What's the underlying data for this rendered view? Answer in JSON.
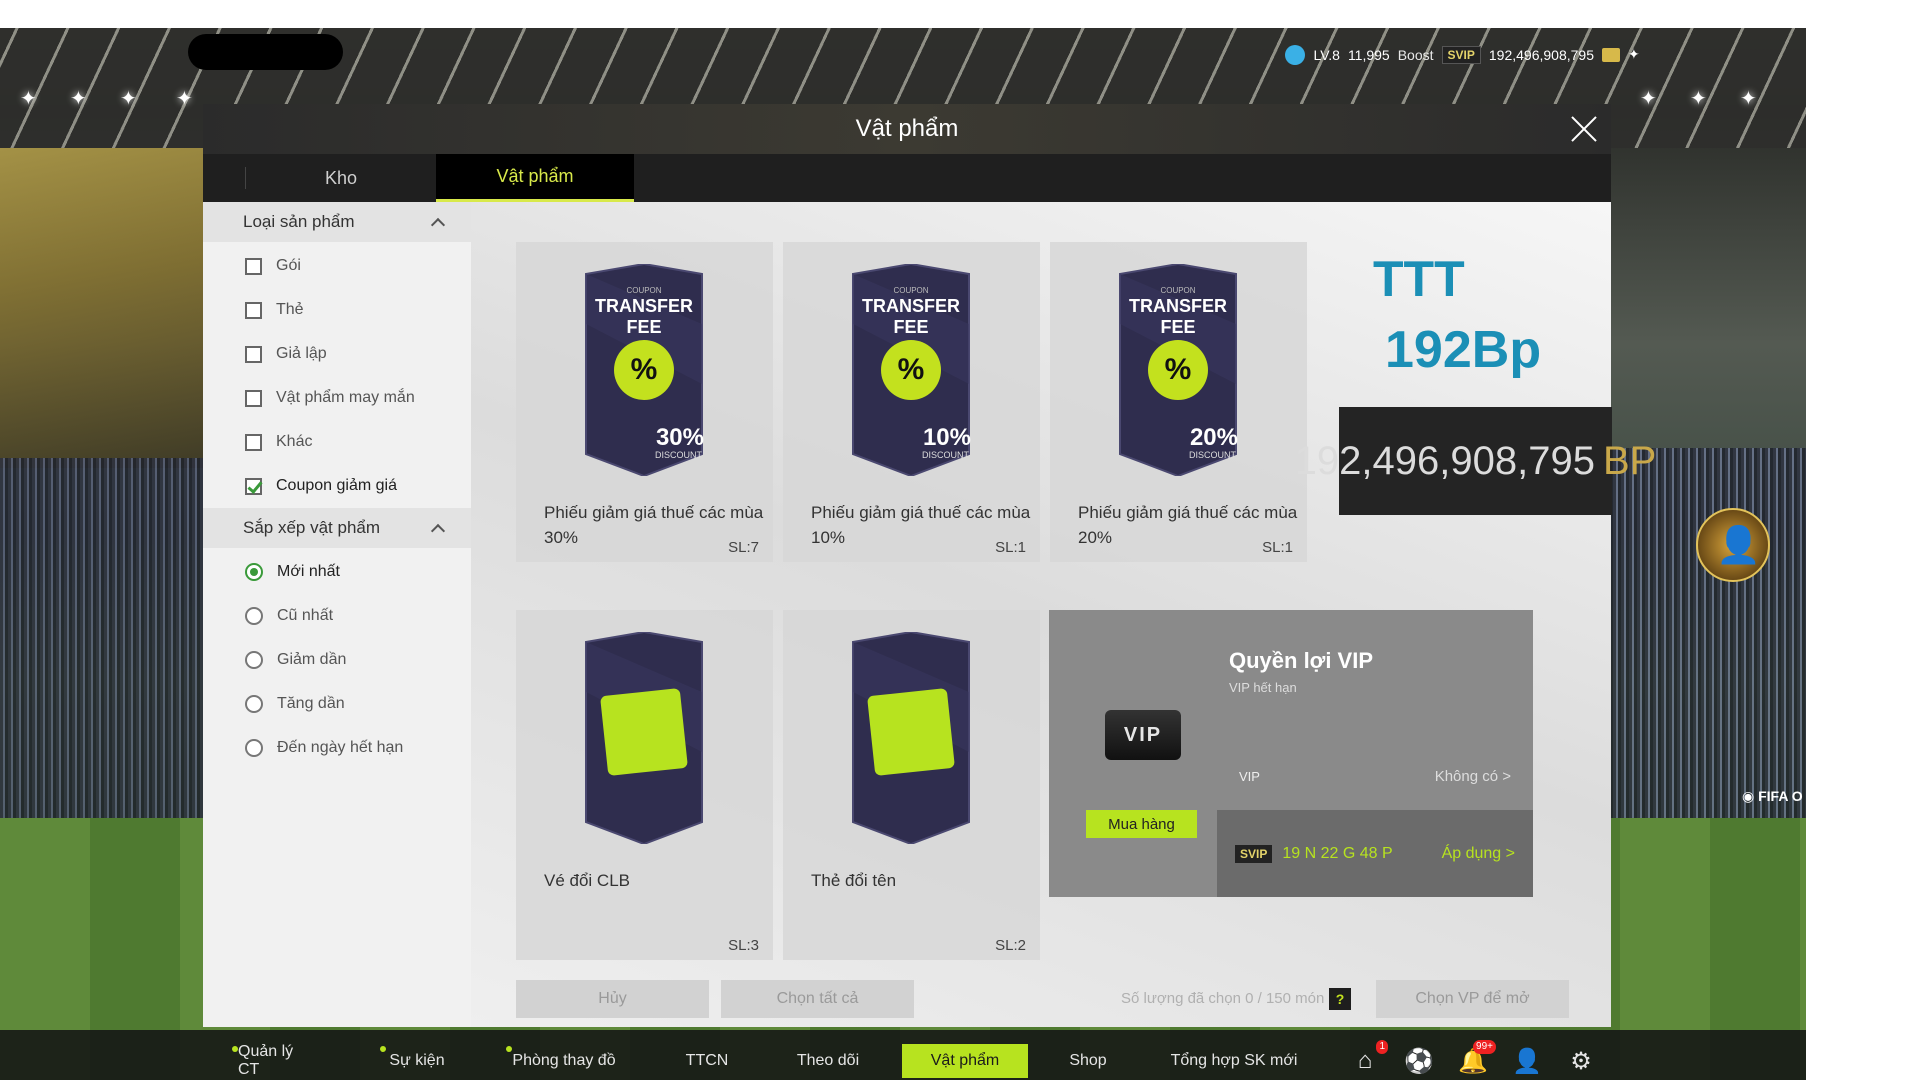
{
  "topbar": {
    "level": "LV.8",
    "points": "11,995",
    "boost": "Boost",
    "svip": "SVIP",
    "bp": "192,496,908,795"
  },
  "window": {
    "title": "Vật phẩm"
  },
  "tabs": [
    {
      "label": "Kho"
    },
    {
      "label": "Vật phẩm"
    }
  ],
  "sidebar": {
    "type_header": "Loại sản phẩm",
    "types": [
      {
        "label": "Gói",
        "checked": false
      },
      {
        "label": "Thẻ",
        "checked": false
      },
      {
        "label": "Giả lập",
        "checked": false
      },
      {
        "label": "Vật phẩm may mắn",
        "checked": false
      },
      {
        "label": "Khác",
        "checked": false
      },
      {
        "label": "Coupon giảm giá",
        "checked": true
      }
    ],
    "sort_header": "Sắp xếp vật phẩm",
    "sorts": [
      {
        "label": "Mới nhất",
        "selected": true
      },
      {
        "label": "Cũ nhất",
        "selected": false
      },
      {
        "label": "Giảm dần",
        "selected": false
      },
      {
        "label": "Tăng dần",
        "selected": false
      },
      {
        "label": "Đến ngày hết hạn",
        "selected": false
      }
    ]
  },
  "items": [
    {
      "name": "Phiếu giảm giá thuế các mùa 30%",
      "qty": "SL:7",
      "coupon_word": "COUPON",
      "coupon_title": "TRANSFER FEE",
      "pct": "30%",
      "pct_sub": "DISCOUNT"
    },
    {
      "name": "Phiếu giảm giá thuế các mùa 10%",
      "qty": "SL:1",
      "coupon_word": "COUPON",
      "coupon_title": "TRANSFER FEE",
      "pct": "10%",
      "pct_sub": "DISCOUNT"
    },
    {
      "name": "Phiếu giảm giá thuế các mùa 20%",
      "qty": "SL:1",
      "coupon_word": "COUPON",
      "coupon_title": "TRANSFER FEE",
      "pct": "20%",
      "pct_sub": "DISCOUNT"
    },
    {
      "name": "Vé đổi CLB",
      "qty": "SL:3"
    },
    {
      "name": "Thẻ đổi tên",
      "qty": "SL:2"
    }
  ],
  "notes": {
    "ttt": "TTT",
    "bp_short": "192Bp",
    "bp_full": "192,496,908,795",
    "bp_unit": "BP"
  },
  "vip": {
    "title": "Quyền lợi VIP",
    "subtitle": "VIP hết hạn",
    "logo": "VIP",
    "buy": "Mua hàng",
    "vip_label": "VIP",
    "vip_value": "Không có  >",
    "svip_label": "SVIP",
    "svip_time": "19 N 22 G 48 P",
    "svip_action": "Áp dụng  >"
  },
  "actions": {
    "cancel": "Hủy",
    "select_all": "Chọn tất cả",
    "count": "Số lượng đã chọn 0 / 150 món",
    "help": "?",
    "open": "Chọn VP để mở"
  },
  "nav": [
    {
      "label": "Quản lý CT",
      "dot": true
    },
    {
      "label": "Sự kiện",
      "dot": true
    },
    {
      "label": "Phòng thay đồ",
      "dot": true
    },
    {
      "label": "TTCN",
      "dot": false
    },
    {
      "label": "Theo dõi",
      "dot": false
    },
    {
      "label": "Vật phẩm",
      "dot": false
    },
    {
      "label": "Shop",
      "dot": false
    },
    {
      "label": "Tổng hợp SK mới",
      "dot": false
    }
  ],
  "nav_badges": {
    "home": "1",
    "bell": "99+"
  },
  "icons": [
    "home-icon",
    "ball-icon",
    "bell-icon",
    "profile-icon",
    "gear-icon"
  ]
}
